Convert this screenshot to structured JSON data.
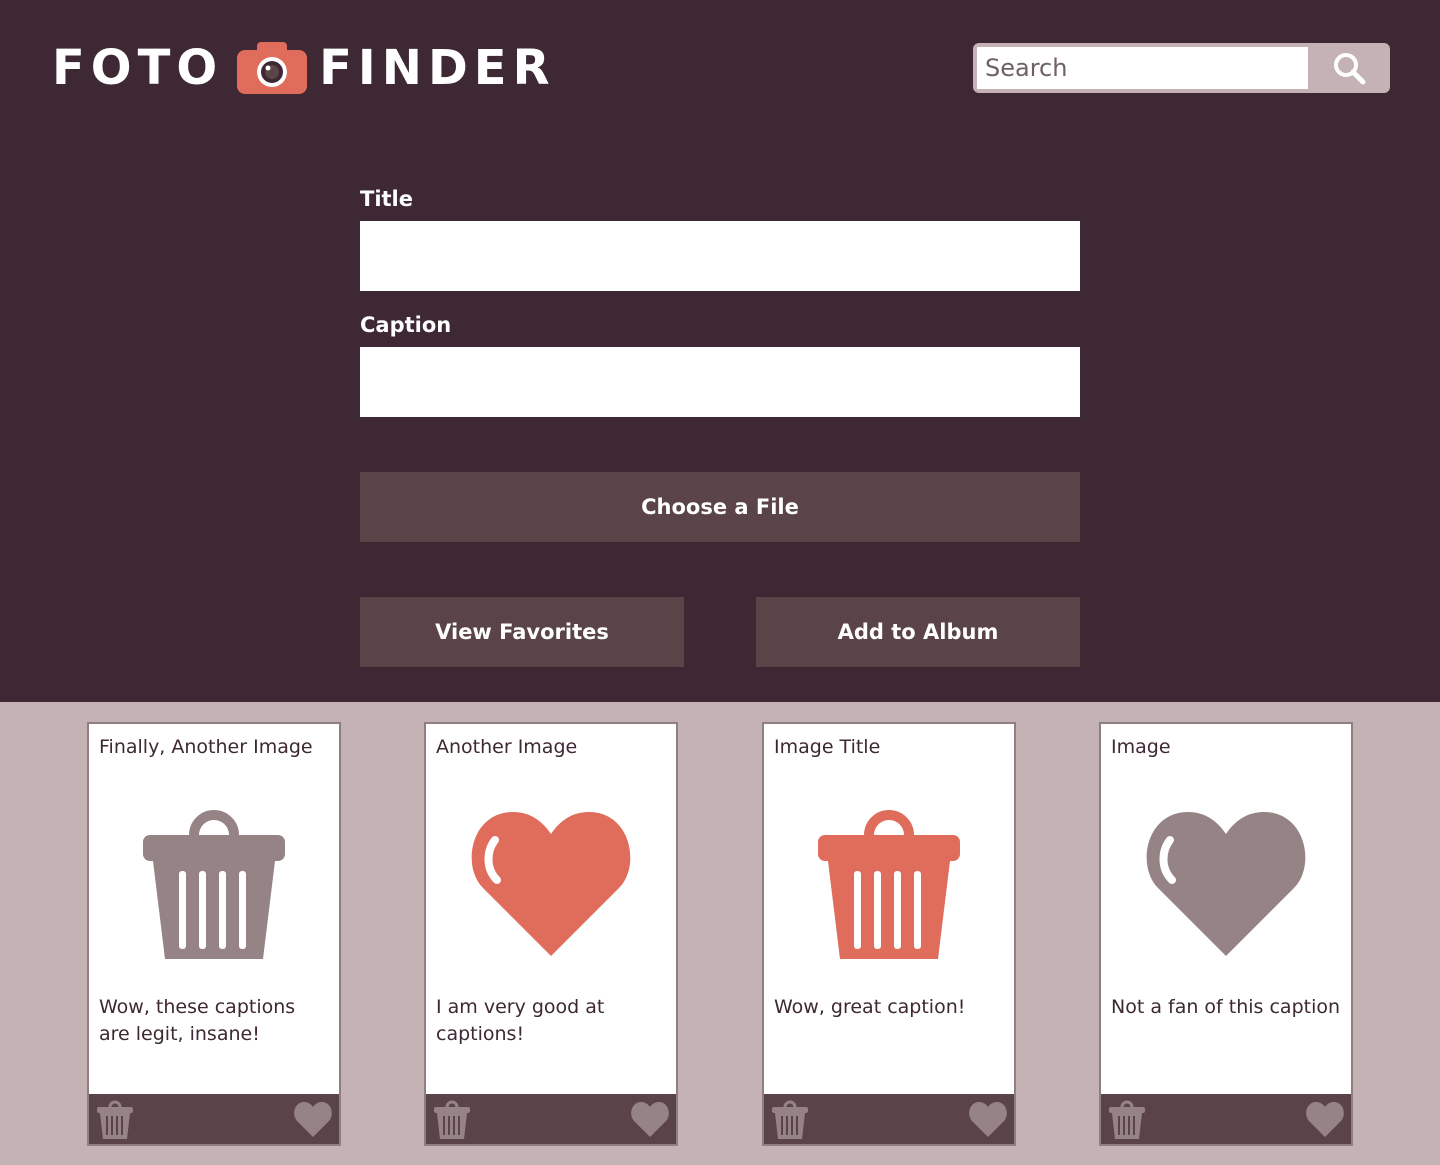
{
  "header": {
    "logo_left": "FOTO",
    "logo_right": "FINDER",
    "search_placeholder": "Search"
  },
  "form": {
    "title_label": "Title",
    "caption_label": "Caption",
    "title_value": "",
    "caption_value": "",
    "choose_file_label": "Choose a File",
    "view_favorites_label": "View Favorites",
    "add_to_album_label": "Add to Album"
  },
  "cards": [
    {
      "title": "Finally, Another Image",
      "caption": "Wow, these captions are legit, insane!",
      "icon": "trash-icon",
      "icon_color": "#968385"
    },
    {
      "title": "Another Image",
      "caption": "I am very good at captions!",
      "icon": "heart-icon",
      "icon_color": "#e06c5c"
    },
    {
      "title": "Image Title",
      "caption": "Wow, great caption!",
      "icon": "trash-icon",
      "icon_color": "#e06c5c"
    },
    {
      "title": "Image",
      "caption": "Not a fan of this caption",
      "icon": "heart-icon",
      "icon_color": "#968385"
    }
  ],
  "colors": {
    "header_bg": "#3d2833",
    "page_bg": "#c4b2b4",
    "button_bg": "#5b4448",
    "accent": "#e06c5c",
    "muted_icon": "#968385"
  }
}
